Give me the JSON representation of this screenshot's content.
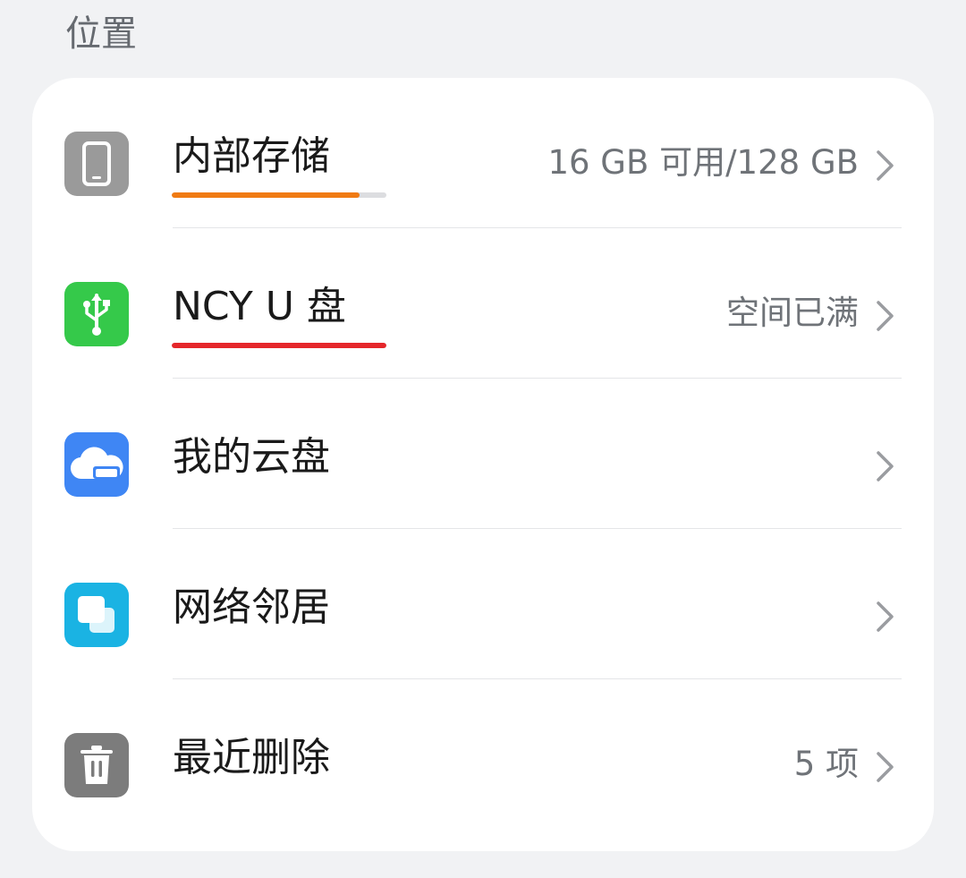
{
  "section": {
    "title": "位置"
  },
  "colors": {
    "internal_bar": "#f07a12",
    "usb_bar": "#e5262a",
    "internal_icon_bg": "#9a9a9a",
    "usb_icon_bg": "#35c94a",
    "cloud_icon_bg": "#3f86f4",
    "network_icon_bg": "#1ab3e3",
    "trash_icon_bg": "#7c7c7c"
  },
  "items": [
    {
      "label": "内部存储",
      "value": "16 GB 可用/128 GB",
      "icon": "phone-icon",
      "usage_fraction": 0.875
    },
    {
      "label": "NCY U 盘",
      "value": "空间已满",
      "icon": "usb-icon",
      "usage_fraction": 1.0
    },
    {
      "label": "我的云盘",
      "value": "",
      "icon": "cloud-drive-icon"
    },
    {
      "label": "网络邻居",
      "value": "",
      "icon": "network-neighbor-icon"
    },
    {
      "label": "最近删除",
      "value": "5 项",
      "icon": "trash-icon"
    }
  ]
}
